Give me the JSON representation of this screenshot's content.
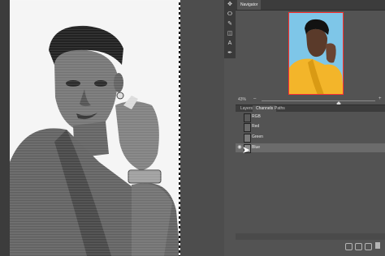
{
  "tools": {
    "icons": [
      "move-tool-icon",
      "lasso-tool-icon",
      "brush-tool-icon",
      "eraser-tool-icon",
      "type-tool-icon",
      "pen-tool-icon",
      "hand-tool-icon",
      "zoom-tool-icon"
    ],
    "glyphs": [
      "✥",
      "ⵔ",
      "✎",
      "◫",
      "A",
      "✒",
      "✋",
      "⚲"
    ]
  },
  "navigator": {
    "tab_label": "Navigator",
    "zoom": "43%",
    "minus": "–",
    "plus": "+",
    "frame_color": "#ff3030"
  },
  "panels": {
    "tabs": [
      {
        "label": "Layers"
      },
      {
        "label": "Channels"
      },
      {
        "label": "Paths"
      }
    ],
    "active_tab": "Channels"
  },
  "channels": [
    {
      "name": "RGB",
      "visible": false,
      "selected": false
    },
    {
      "name": "Red",
      "visible": false,
      "selected": false
    },
    {
      "name": "Green",
      "visible": false,
      "selected": false
    },
    {
      "name": "Blue",
      "visible": true,
      "selected": true
    }
  ],
  "colors": {
    "panel_bg": "#535353",
    "header_bg": "#3c3c3c",
    "selected_row": "#6b6b6b",
    "thumb_bg": "#7ec6e8",
    "jacket": "#f3b52a"
  }
}
